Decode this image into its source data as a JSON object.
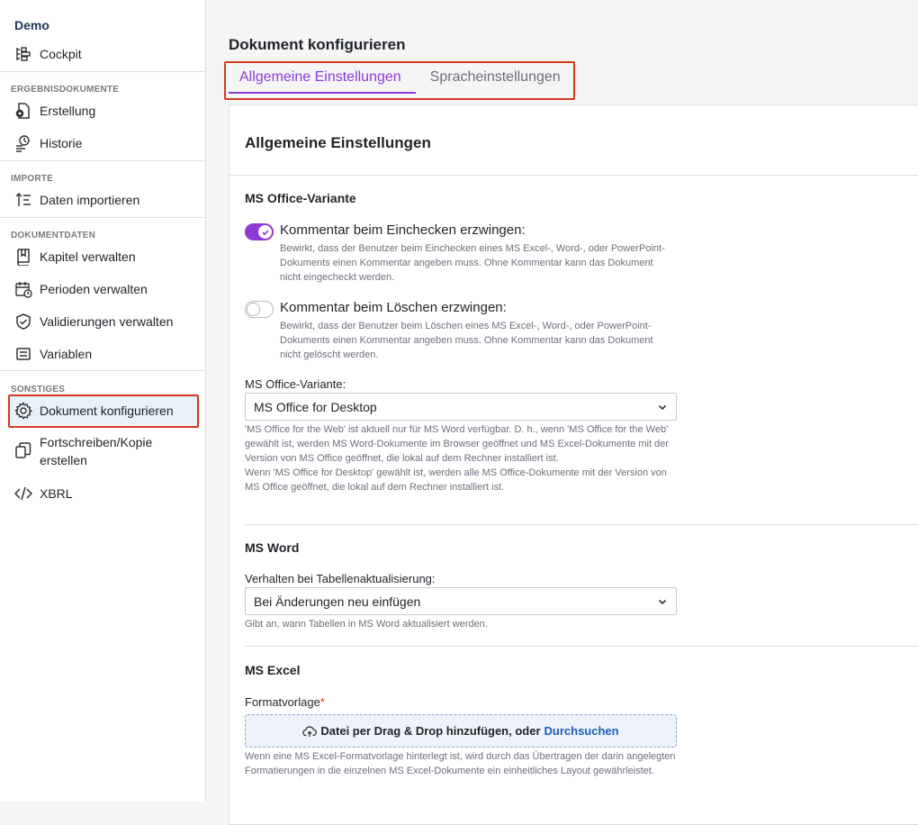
{
  "sidebar": {
    "app_name": "Demo",
    "cockpit": "Cockpit",
    "sections": {
      "ergebnis": "ERGEBNISDOKUMENTE",
      "importe": "IMPORTE",
      "dokumentdaten": "DOKUMENTDATEN",
      "sonstiges": "SONSTIGES"
    },
    "items": {
      "erstellung": "Erstellung",
      "historie": "Historie",
      "daten_importieren": "Daten importieren",
      "kapitel": "Kapitel verwalten",
      "perioden": "Perioden verwalten",
      "validierungen": "Validierungen verwalten",
      "variablen": "Variablen",
      "dokument_konfigurieren": "Dokument konfigurieren",
      "fortschreiben_1": "Fortschreiben/Kopie",
      "fortschreiben_2": "erstellen",
      "xbrl": "XBRL"
    }
  },
  "main": {
    "page_title": "Dokument konfigurieren",
    "tabs": [
      "Allgemeine Einstellungen",
      "Spracheinstellungen"
    ],
    "active_tab": 0,
    "card_title": "Allgemeine Einstellungen",
    "office": {
      "section_title": "MS Office-Variante",
      "toggle_checkin": {
        "label": "Kommentar beim Einchecken erzwingen:",
        "on": true,
        "desc": "Bewirkt, dass der Benutzer beim Einchecken eines MS Excel-, Word-, oder PowerPoint-Dokuments einen Kommentar angeben muss. Ohne Kommentar kann das Dokument nicht eingecheckt werden."
      },
      "toggle_delete": {
        "label": "Kommentar beim Löschen erzwingen:",
        "on": false,
        "desc": "Bewirkt, dass der Benutzer beim Löschen eines MS Excel-, Word-, oder PowerPoint-Dokuments einen Kommentar angeben muss. Ohne Kommentar kann das Dokument nicht gelöscht werden."
      },
      "variant_label": "MS Office-Variante:",
      "variant_value": "MS Office for Desktop",
      "variant_help_1": "'MS Office for the Web' ist aktuell nur für MS Word verfügbar. D. h., wenn 'MS Office for the Web' gewählt ist, werden MS Word-Dokumente im Browser geöffnet und MS Excel-Dokumente mit der Version von MS Office geöffnet, die lokal auf dem Rechner installiert ist.",
      "variant_help_2": "Wenn 'MS Office for Desktop' gewählt ist, werden alle MS Office-Dokumente mit der Version von MS Office geöffnet, die lokal auf dem Rechner installiert ist."
    },
    "word": {
      "section_title": "MS Word",
      "field_label": "Verhalten bei Tabellenaktualisierung:",
      "field_value": "Bei Änderungen neu einfügen",
      "help": "Gibt an, wann Tabellen in MS Word aktualisiert werden."
    },
    "excel": {
      "section_title": "MS Excel",
      "field_label": "Formatvorlage",
      "required_mark": "*",
      "dropzone_text": "Datei per Drag & Drop hinzufügen, oder",
      "dropzone_link": "Durchsuchen",
      "help": "Wenn eine MS Excel-Formatvorlage hinterlegt ist, wird durch das Übertragen der darin angelegten Formatierungen in die einzelnen MS Excel-Dokumente ein einheitliches Layout gewährleistet."
    }
  },
  "colors": {
    "accent": "#8e3bd6",
    "highlight_box": "#d2391f",
    "link": "#1a5fb4"
  }
}
